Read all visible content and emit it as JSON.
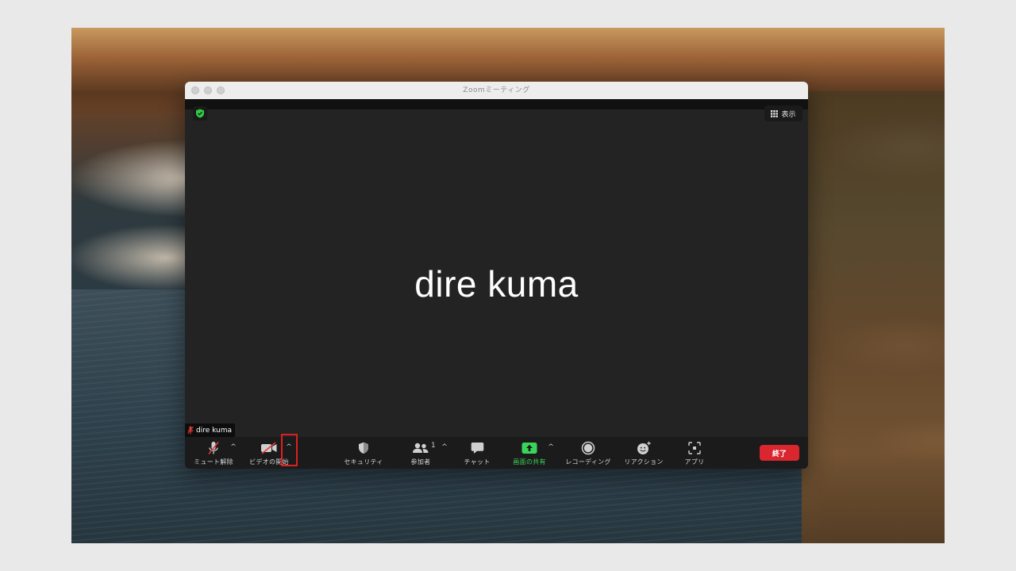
{
  "window": {
    "title": "Zoomミーティング"
  },
  "stage": {
    "view_label": "表示",
    "participant_display_name": "dire kuma",
    "name_tag": "dire kuma"
  },
  "toolbar": {
    "mute_label": "ミュート解除",
    "video_label": "ビデオの開始",
    "security_label": "セキュリティ",
    "participants_label": "参加者",
    "participants_count": "1",
    "chat_label": "チャット",
    "share_label": "画面の共有",
    "recording_label": "レコーディング",
    "reactions_label": "リアクション",
    "apps_label": "アプリ",
    "end_label": "終了",
    "caret": "^"
  },
  "colors": {
    "window_bg": "#232323",
    "toolbar_bg": "#1b1b1b",
    "share_green": "#3ad45a",
    "end_red": "#d9262f",
    "highlight_red": "#e0201f",
    "shield_green": "#2ecc40"
  },
  "icons": {
    "shield": "shield-check-icon",
    "view": "grid-icon",
    "mute": "microphone-muted-icon",
    "video": "video-camera-off-icon",
    "security": "shield-icon",
    "participants": "people-icon",
    "chat": "chat-bubble-icon",
    "share": "share-screen-arrow-icon",
    "record": "record-circle-icon",
    "reactions": "smiley-plus-icon",
    "apps": "apps-icon"
  }
}
